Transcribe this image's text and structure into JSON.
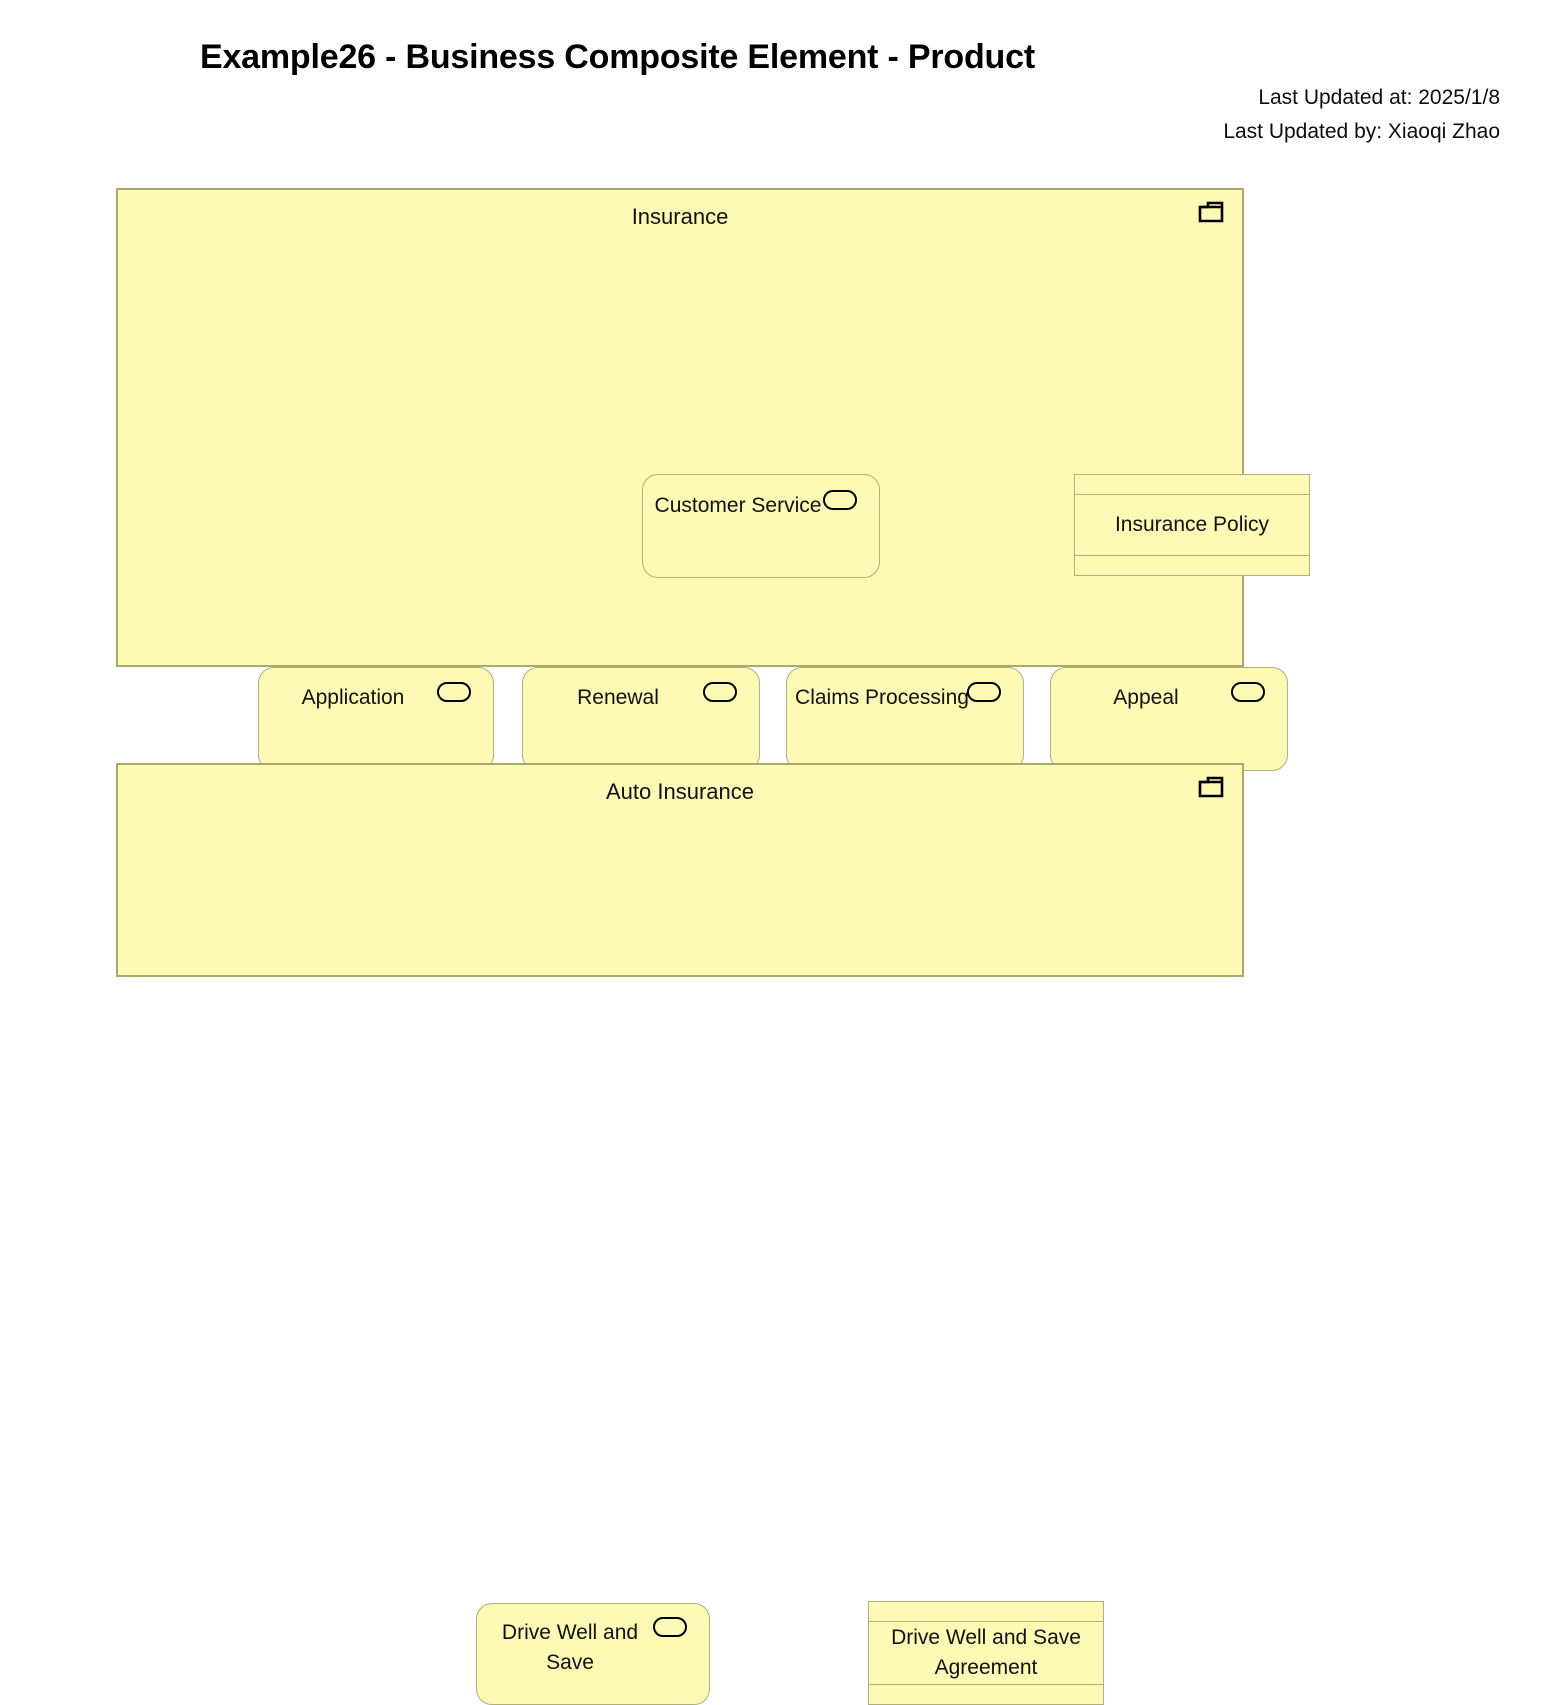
{
  "header": {
    "title": "Example26 - Business Composite Element - Product",
    "updated_at": "Last Updated at: 2025/1/8",
    "updated_by": "Last Updated by: Xiaoqi Zhao"
  },
  "colors": {
    "package_fill": "#fcfab4",
    "package_border": "#a9a96b",
    "element_border": "#b0b078",
    "connector": "#000000",
    "diamond_fill": "#eeeeff",
    "text": "#111111"
  },
  "packages": [
    {
      "id": "insurance",
      "name": "Insurance",
      "icon": "package-icon",
      "services": [
        {
          "id": "customer-service",
          "name": "Customer Service",
          "icon": "business-service-icon"
        },
        {
          "id": "application",
          "name": "Application",
          "icon": "business-service-icon"
        },
        {
          "id": "renewal",
          "name": "Renewal",
          "icon": "business-service-icon"
        },
        {
          "id": "claims-processing",
          "name": "Claims Processing",
          "icon": "business-service-icon"
        },
        {
          "id": "appeal",
          "name": "Appeal",
          "icon": "business-service-icon"
        }
      ],
      "objects": [
        {
          "id": "insurance-policy",
          "name": "Insurance Policy"
        }
      ]
    },
    {
      "id": "auto-insurance",
      "name": "Auto Insurance",
      "icon": "package-icon",
      "services": [
        {
          "id": "drive-well-and-save",
          "name": "Drive Well and Save",
          "icon": "business-service-icon"
        }
      ],
      "objects": [
        {
          "id": "drive-well-and-save-agreement",
          "name": "Drive Well and Save Agreement"
        }
      ]
    }
  ],
  "relationships": [
    {
      "type": "aggregation",
      "whole": "Customer Service",
      "part": "Application",
      "marker": "hollow-diamond"
    },
    {
      "type": "aggregation",
      "whole": "Customer Service",
      "part": "Renewal",
      "marker": "hollow-diamond"
    },
    {
      "type": "aggregation",
      "whole": "Customer Service",
      "part": "Claims Processing",
      "marker": "hollow-diamond"
    },
    {
      "type": "aggregation",
      "whole": "Customer Service",
      "part": "Appeal",
      "marker": "hollow-diamond"
    },
    {
      "type": "generalization",
      "general": "Insurance",
      "specific": "Auto Insurance",
      "marker": "hollow-triangle"
    }
  ]
}
